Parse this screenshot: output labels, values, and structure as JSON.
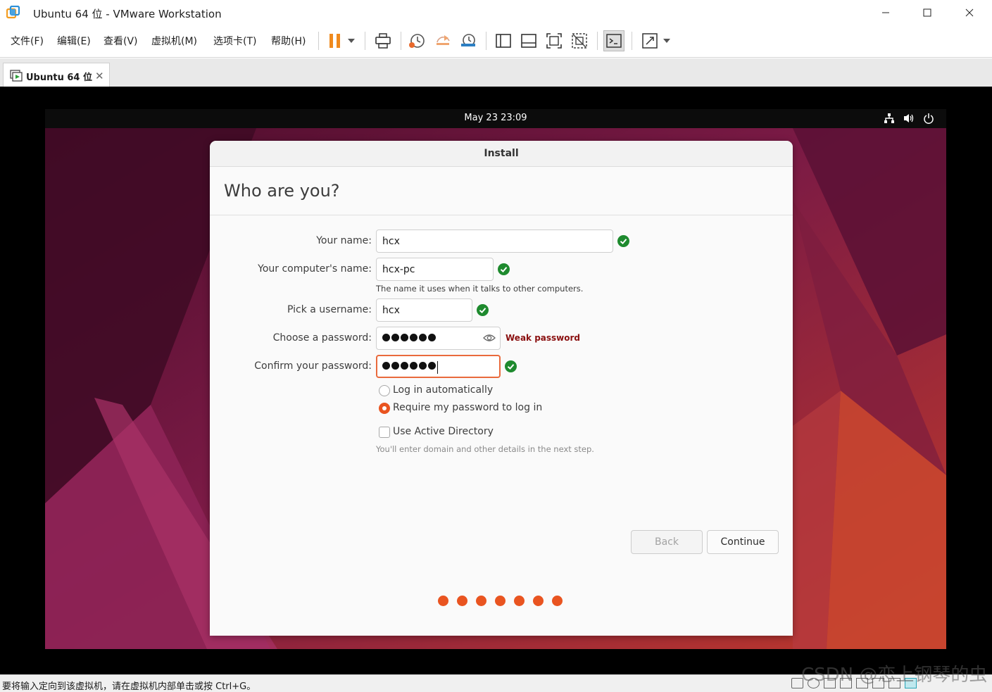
{
  "window": {
    "title": "Ubuntu 64 位 - VMware Workstation",
    "controls": [
      "minimize",
      "maximize",
      "close"
    ]
  },
  "menu": {
    "items": [
      "文件(F)",
      "编辑(E)",
      "查看(V)",
      "虚拟机(M)",
      "选项卡(T)",
      "帮助(H)"
    ]
  },
  "toolbar": {
    "icons": [
      "pause-icon",
      "dropdown-icon",
      "send-ctrl-alt-del-icon",
      "snapshot-icon",
      "revert-snapshot-icon",
      "snapshot-manager-icon",
      "show-library-icon",
      "thumbnail-bar-icon",
      "full-screen-icon",
      "unity-icon",
      "console-view-icon",
      "stretch-icon",
      "dropdown-icon"
    ]
  },
  "tabs": [
    {
      "label": "Ubuntu 64 位",
      "active": true
    }
  ],
  "ubuntu": {
    "clock": "May 23  23:09",
    "tray_icons": [
      "network-icon",
      "volume-icon",
      "power-icon"
    ]
  },
  "installer": {
    "window_title": "Install",
    "heading": "Who are you?",
    "fields": {
      "name": {
        "label": "Your name:",
        "value": "hcx",
        "valid": true
      },
      "computer_name": {
        "label": "Your computer's name:",
        "value": "hcx-pc",
        "valid": true,
        "hint": "The name it uses when it talks to other computers."
      },
      "username": {
        "label": "Pick a username:",
        "value": "hcx",
        "valid": true
      },
      "password": {
        "label": "Choose a password:",
        "masked_length": 6,
        "strength": "Weak password"
      },
      "confirm_password": {
        "label": "Confirm your password:",
        "masked_length": 6,
        "valid": true
      }
    },
    "login_options": [
      {
        "label": "Log in automatically",
        "selected": false
      },
      {
        "label": "Require my password to log in",
        "selected": true
      }
    ],
    "active_directory": {
      "label": "Use Active Directory",
      "checked": false,
      "hint": "You'll enter domain and other details in the next step."
    },
    "buttons": {
      "back": "Back",
      "continue": "Continue"
    },
    "progress_steps": 7,
    "accent_color": "#e95420"
  },
  "statusbar": {
    "text": "要将输入定向到该虚拟机，请在虚拟机内部单击或按 Ctrl+G。",
    "watermark": "CSDN @恋上钢琴的虫"
  }
}
